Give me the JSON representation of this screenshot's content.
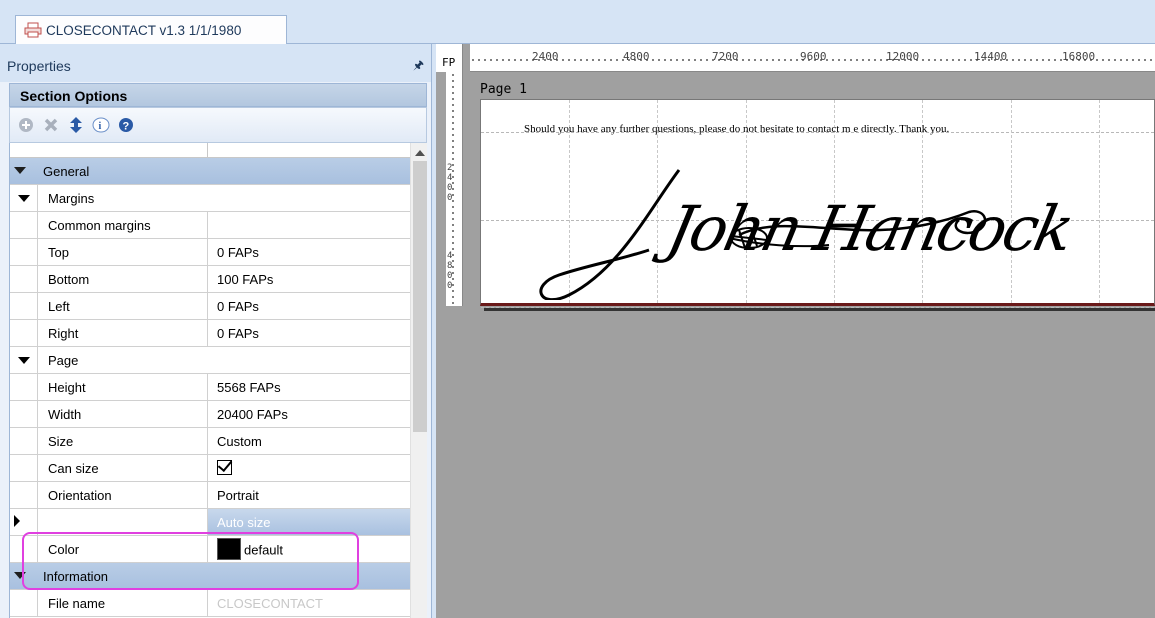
{
  "tab": {
    "title": "CLOSECONTACT v1.3 1/1/1980"
  },
  "properties": {
    "title": "Properties",
    "pin_icon": "pin-icon",
    "section_title": "Section Options",
    "toolbar_icons": [
      "add-icon",
      "delete-icon",
      "move-icon",
      "info-icon",
      "help-icon"
    ]
  },
  "grid": {
    "general": "General",
    "margins": "Margins",
    "common_margins": "Common margins",
    "top": {
      "label": "Top",
      "value": "0 FAPs"
    },
    "bottom": {
      "label": "Bottom",
      "value": "100 FAPs"
    },
    "left": {
      "label": "Left",
      "value": "0 FAPs"
    },
    "right": {
      "label": "Right",
      "value": "0 FAPs"
    },
    "page": "Page",
    "height": {
      "label": "Height",
      "value": "5568 FAPs"
    },
    "width": {
      "label": "Width",
      "value": "20400 FAPs"
    },
    "size": {
      "label": "Size",
      "value": "Custom"
    },
    "can_size": {
      "label": "Can size",
      "checked": true
    },
    "orientation": {
      "label": "Orientation",
      "value": "Portrait"
    },
    "auto_size": {
      "label": "",
      "value": "Auto size"
    },
    "color": {
      "label": "Color",
      "value": "default",
      "swatch": "#000000"
    },
    "information": "Information",
    "file_name": {
      "label": "File name",
      "value": "CLOSECONTACT"
    }
  },
  "ruler": {
    "unit": "FP",
    "h_labels": [
      "2400",
      "4800",
      "7200",
      "9600",
      "12000",
      "14400",
      "16800"
    ],
    "v_labels": [
      "2",
      "4",
      "0",
      "0",
      "4",
      "8",
      "0",
      "0"
    ]
  },
  "preview": {
    "page_label": "Page 1",
    "body_text": "Should you have any further questions, please do not hesitate to contact m e directly.  Thank you.",
    "signature": "John Hancock"
  },
  "colors": {
    "highlight": "#e040e0",
    "selection": "#a9c1e0",
    "canvas": "#a0a0a0"
  }
}
